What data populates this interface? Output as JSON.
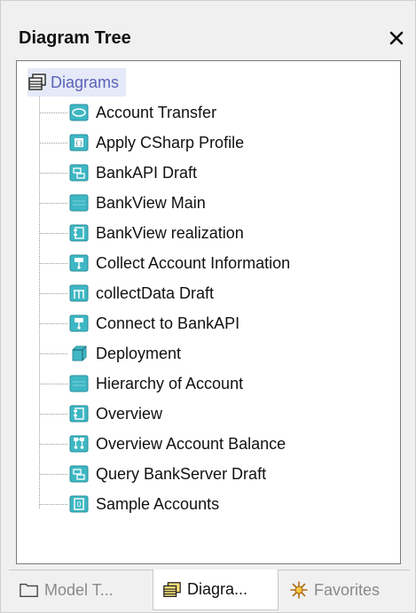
{
  "window": {
    "title": "Diagram Tree"
  },
  "tree": {
    "root_label": "Diagrams",
    "items": [
      {
        "label": "Account Transfer",
        "icon": "usecase-diagram-icon"
      },
      {
        "label": "Apply CSharp Profile",
        "icon": "profile-diagram-icon"
      },
      {
        "label": "BankAPI Draft",
        "icon": "class-diagram-icon"
      },
      {
        "label": "BankView Main",
        "icon": "package-diagram-icon"
      },
      {
        "label": "BankView realization",
        "icon": "component-diagram-icon"
      },
      {
        "label": "Collect Account Information",
        "icon": "activity-diagram-icon"
      },
      {
        "label": "collectData Draft",
        "icon": "composite-structure-diagram-icon"
      },
      {
        "label": "Connect to BankAPI",
        "icon": "activity-diagram-icon"
      },
      {
        "label": "Deployment",
        "icon": "deployment-diagram-icon"
      },
      {
        "label": "Hierarchy of Account",
        "icon": "package-diagram-icon"
      },
      {
        "label": "Overview",
        "icon": "component-diagram-icon"
      },
      {
        "label": "Overview Account Balance",
        "icon": "communication-diagram-icon"
      },
      {
        "label": "Query BankServer Draft",
        "icon": "class-diagram-icon"
      },
      {
        "label": "Sample Accounts",
        "icon": "object-diagram-icon"
      }
    ]
  },
  "tabs": [
    {
      "label": "Model T...",
      "icon": "folder-icon",
      "active": false
    },
    {
      "label": "Diagra...",
      "icon": "diagrams-icon",
      "active": true
    },
    {
      "label": "Favorites",
      "icon": "star-icon",
      "active": false
    }
  ],
  "colors": {
    "icon_teal": "#3fb7c4",
    "root_highlight": "#e5e9f8",
    "root_text": "#5a63b8"
  }
}
